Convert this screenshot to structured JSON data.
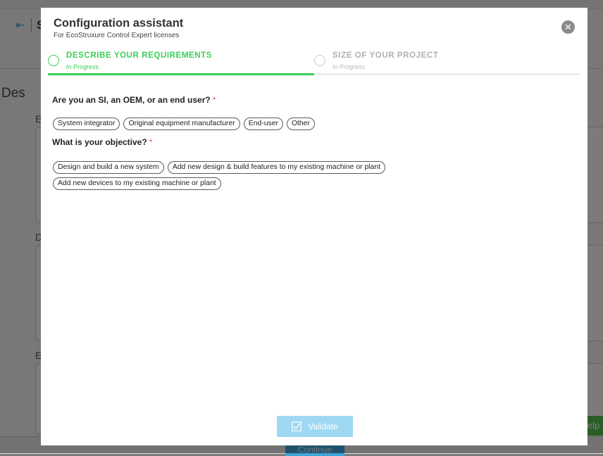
{
  "background": {
    "partial_title_letter": "S",
    "section_heading_fragment": "Des",
    "field_label_fragments": [
      "E",
      "D",
      "E"
    ],
    "help_fragment": "elp",
    "continue_label": "Continue"
  },
  "modal": {
    "title": "Configuration assistant",
    "subtitle": "For EcoStruxure Control Expert licenses",
    "close_icon": "close-icon"
  },
  "steps": [
    {
      "label": "DESCRIBE YOUR REQUIREMENTS",
      "status": "In Progress",
      "active": true
    },
    {
      "label": "SIZE OF YOUR PROJECT",
      "status": "In Progress",
      "active": false
    }
  ],
  "progress_fraction": 0.5,
  "questions": [
    {
      "text": "Are you an SI, an OEM, or an end user?",
      "required_mark": "*",
      "options": [
        "System integrator",
        "Original equipment manufacturer",
        "End-user",
        "Other"
      ]
    },
    {
      "text": "What is your objective?",
      "required_mark": "*",
      "options": [
        "Design and build a new system",
        "Add new design & build features to my existing machine or plant",
        "Add new devices to my existing machine or plant"
      ]
    }
  ],
  "validate": {
    "label": "Validate",
    "icon": "checkbox-icon"
  },
  "colors": {
    "accent_green": "#3dcd58",
    "required_red": "#e4574c",
    "validate_blue": "#9fd8f2",
    "help_green": "#55b84d"
  }
}
